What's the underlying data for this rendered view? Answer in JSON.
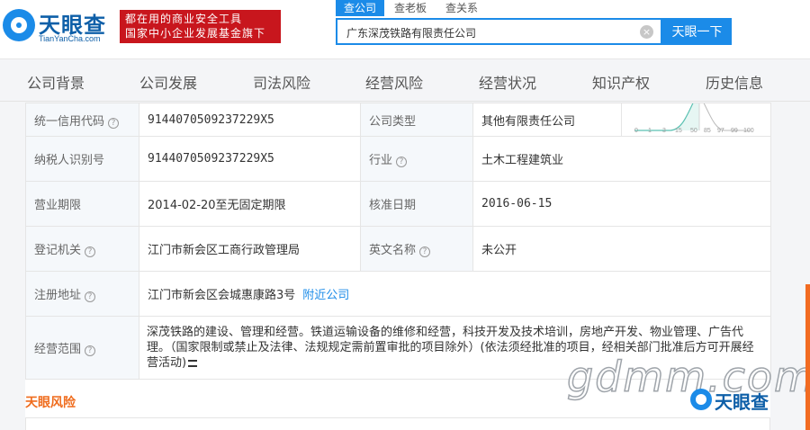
{
  "header": {
    "logo_name": "天眼查",
    "logo_sub": "TianYanCha.com",
    "slogan_line1": "都在用的商业安全工具",
    "slogan_line2": "国家中小企业发展基金旗下",
    "search_tabs": [
      "查公司",
      "查老板",
      "查关系"
    ],
    "search_value": "广东深茂铁路有限责任公司",
    "clear_glyph": "×",
    "search_button": "天眼一下"
  },
  "nav": {
    "items": [
      "公司背景",
      "公司发展",
      "司法风险",
      "经营风险",
      "经营状况",
      "知识产权",
      "历史信息"
    ]
  },
  "info": {
    "credit_code_label": "统一信用代码",
    "credit_code": "9144070509237229X5",
    "company_type_label": "公司类型",
    "company_type": "其他有限责任公司",
    "taxpayer_id_label": "纳税人识别号",
    "taxpayer_id": "9144070509237229X5",
    "industry_label": "行业",
    "industry": "土木工程建筑业",
    "term_label": "营业期限",
    "term": "2014-02-20至无固定期限",
    "approval_date_label": "核准日期",
    "approval_date": "2016-06-15",
    "authority_label": "登记机关",
    "authority": "江门市新会区工商行政管理局",
    "english_name_label": "英文名称",
    "english_name": "未公开",
    "address_label": "注册地址",
    "address": "江门市新会区会城惠康路3号",
    "nearby_link": "附近公司",
    "scope_label": "经营范围",
    "scope": "深茂铁路的建设、管理和经营。铁道运输设备的维修和经营，科技开发及技术培训，房地产开发、物业管理、广告代理。（国家限制或禁止及法律、法规规定需前置审批的项目除外）(依法须经批准的项目，经相关部门批准后方可开展经营活动)",
    "help_glyph": "?"
  },
  "mini_chart": {
    "x_ticks": [
      "0",
      "1",
      "3",
      "15",
      "50",
      "85",
      "97",
      "99",
      "100"
    ],
    "accent": "#5bc1b2"
  },
  "section": {
    "risk_title": "天眼风险"
  },
  "watermark": {
    "text": "gdmm.com",
    "logo_name": "天眼查"
  },
  "colors": {
    "brand_blue": "#1b8be8",
    "slogan_red": "#c8161d",
    "section_orange": "#ef6c1d",
    "label_bg": "#f5f8fb"
  }
}
